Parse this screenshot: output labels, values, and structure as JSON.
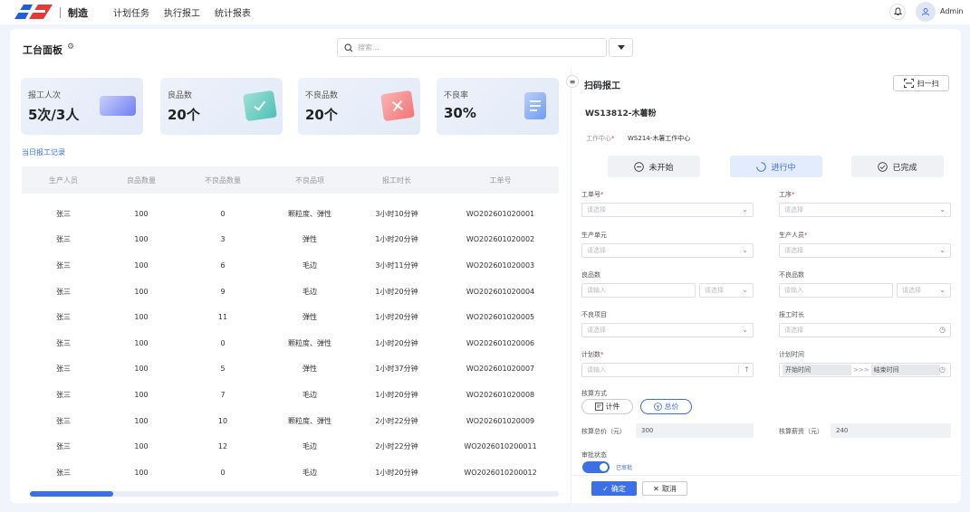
{
  "topbar": {
    "brand": "制造",
    "nav": [
      "计划任务",
      "执行报工",
      "统计报表"
    ],
    "user": "Admin",
    "bell_icon": "bell-icon",
    "avatar_icon": "user-icon"
  },
  "page": {
    "title": "工台面板",
    "search_placeholder": "搜索..."
  },
  "stats": [
    {
      "label": "报工人次",
      "value": "5次/3人",
      "icon": "chat-cards-icon",
      "color": "#6e7ff3"
    },
    {
      "label": "良品数",
      "value": "20个",
      "icon": "check-card-icon",
      "color": "#4fbfb4"
    },
    {
      "label": "不良品数",
      "value": "20个",
      "icon": "x-card-icon",
      "color": "#f07575"
    },
    {
      "label": "不良率",
      "value": "30%",
      "icon": "document-icon",
      "color": "#6f9cf2"
    }
  ],
  "records": {
    "title": "当日报工记录",
    "columns": [
      "生产人员",
      "良品数量",
      "不良品数量",
      "不良品项",
      "报工时长",
      "工单号"
    ],
    "rows": [
      [
        "张三",
        "100",
        "0",
        "颗粒度、弹性",
        "3小时10分钟",
        "WO202601020001"
      ],
      [
        "张三",
        "100",
        "3",
        "弹性",
        "1小时20分钟",
        "WO202601020002"
      ],
      [
        "张三",
        "100",
        "6",
        "毛边",
        "3小时11分钟",
        "WO202601020003"
      ],
      [
        "张三",
        "100",
        "9",
        "毛边",
        "1小时20分钟",
        "WO202601020004"
      ],
      [
        "张三",
        "100",
        "11",
        "弹性",
        "1小时20分钟",
        "WO202601020005"
      ],
      [
        "张三",
        "100",
        "0",
        "颗粒度、弹性",
        "1小时20分钟",
        "WO202601020006"
      ],
      [
        "张三",
        "100",
        "5",
        "弹性",
        "1小时37分钟",
        "WO202601020007"
      ],
      [
        "张三",
        "100",
        "7",
        "毛边",
        "1小时20分钟",
        "WO202601020008"
      ],
      [
        "张三",
        "100",
        "10",
        "颗粒度、弹性",
        "2小时22分钟",
        "WO202601020009"
      ],
      [
        "张三",
        "100",
        "12",
        "毛边",
        "2小时22分钟",
        "WO2026010200011"
      ],
      [
        "张三",
        "100",
        "0",
        "毛边",
        "1小时20分钟",
        "WO2026010200012"
      ]
    ]
  },
  "panel": {
    "title": "扫码报工",
    "scan": "扫一扫",
    "order": "WS13812-木薯粉",
    "work_center_label": "工作中心",
    "work_center_value": "WS214-木薯工作中心",
    "status": {
      "not_started": "未开始",
      "in_progress": "进行中",
      "done": "已完成"
    },
    "fields": {
      "order_no": "工单号",
      "process": "工序",
      "unit": "生产单元",
      "worker": "生产人员",
      "good_qty": "良品数",
      "bad_qty": "不良品数",
      "bad_item": "不良项目",
      "report_time": "报工时长",
      "plan_qty": "计划数",
      "plan_time": "计划时间",
      "calc_method": "核算方式",
      "total_price": "核算总价（元）",
      "total_salary": "核算薪资（元）",
      "approval": "审批状态"
    },
    "placeholders": {
      "select": "请选择",
      "input": "请输入",
      "start": "开始时间",
      "end": "结束时间",
      "arrow": ">>>"
    },
    "methods": {
      "piece": "计件",
      "total": "总价"
    },
    "total_price_value": "300",
    "total_salary_value": "240",
    "approval_value": "已审批",
    "confirm": "确定",
    "cancel": "取消"
  }
}
